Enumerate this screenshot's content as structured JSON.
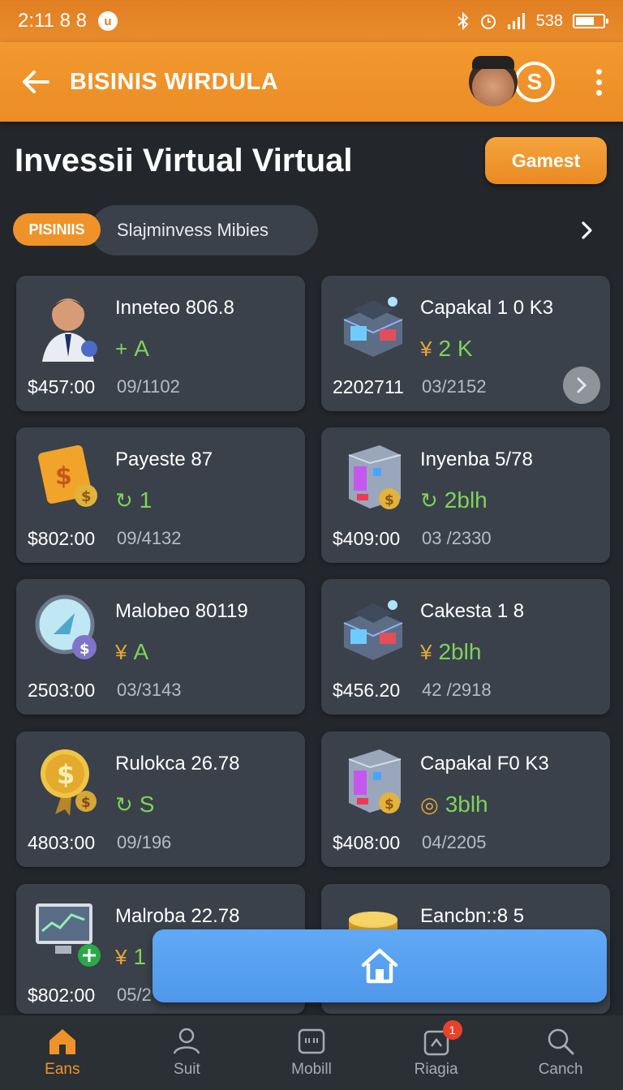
{
  "status_bar": {
    "time": "2:11 8 8",
    "badge": "u",
    "right_text": "538"
  },
  "app_bar": {
    "title": "BISINIS WIRDULA",
    "coin_symbol": "S"
  },
  "heading": "Invessii Virtual Virtual",
  "top_action_label": "Gamest",
  "filter": {
    "tag": "PISINIIS",
    "pill_text": "Slajminvess Mibies"
  },
  "cards": [
    {
      "title": "Inneteo 806.8",
      "stat_symbol": "+",
      "stat_value": "A",
      "price": "$457:00",
      "date": "09/1102",
      "thumb": "businessman-icon",
      "has_chevron": false
    },
    {
      "title": "Capakal 1 0 K3",
      "stat_symbol": "¥",
      "stat_value": "2 K",
      "price": "2202711",
      "date": "03/2152",
      "thumb": "store-icon",
      "has_chevron": true
    },
    {
      "title": "Payeste 87",
      "stat_symbol": "↻",
      "stat_value": "1",
      "price": "$802:00",
      "date": "09/4132",
      "thumb": "cash-icon",
      "has_chevron": false
    },
    {
      "title": "Inyenba 5/78",
      "stat_symbol": "↻",
      "stat_value": "2blh",
      "price": "$409:00",
      "date": "03 /2330",
      "thumb": "vending-icon",
      "has_chevron": false
    },
    {
      "title": "Malobeo 80119",
      "stat_symbol": "¥",
      "stat_value": "A",
      "price": "2503:00",
      "date": "03/3143",
      "thumb": "compass-icon",
      "has_chevron": false
    },
    {
      "title": "Cakesta 1 8",
      "stat_symbol": "¥",
      "stat_value": "2blh",
      "price": "$456.20",
      "date": "42 /2918",
      "thumb": "store-icon",
      "has_chevron": false
    },
    {
      "title": "Rulokca 26.78",
      "stat_symbol": "↻",
      "stat_value": "S",
      "price": "4803:00",
      "date": "09/196",
      "thumb": "medal-icon",
      "has_chevron": false
    },
    {
      "title": "Capakal F0 K3",
      "stat_symbol": "◎",
      "stat_value": "3blh",
      "price": "$408:00",
      "date": "04/2205",
      "thumb": "vending-icon",
      "has_chevron": false
    },
    {
      "title": "Malroba 22.78",
      "stat_symbol": "¥",
      "stat_value": "1",
      "price": "$802:00",
      "date": "05/2",
      "thumb": "monitor-icon",
      "has_chevron": false
    },
    {
      "title": "Eancbn::8 5",
      "stat_symbol": "",
      "stat_value": "",
      "price": "",
      "date": "",
      "thumb": "coins-icon",
      "has_chevron": false
    }
  ],
  "bottom_nav": [
    {
      "label": "Eans",
      "icon": "home-icon",
      "active": true
    },
    {
      "label": "Suit",
      "icon": "person-icon",
      "active": false
    },
    {
      "label": "Mobill",
      "icon": "card-icon",
      "active": false
    },
    {
      "label": "Riagia",
      "icon": "bag-icon",
      "active": false,
      "badge": "1"
    },
    {
      "label": "Canch",
      "icon": "search-icon",
      "active": false
    }
  ],
  "colors": {
    "accent": "#f0922a",
    "background": "#23272c",
    "card": "#3a414a",
    "stat_green": "#7ed35a",
    "float_button": "#5fa9f5"
  }
}
